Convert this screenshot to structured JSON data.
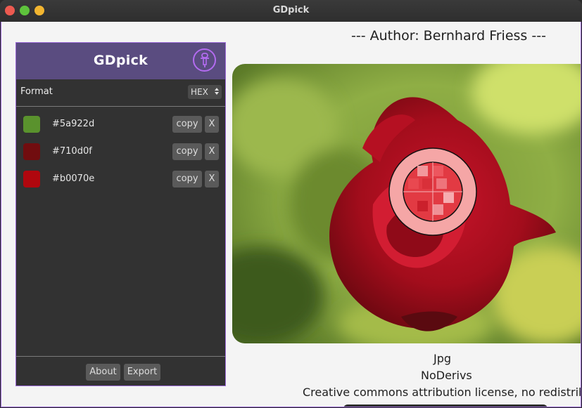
{
  "window": {
    "title": "GDpick"
  },
  "panel": {
    "title": "GDpick",
    "format_label": "Format",
    "format_value": "HEX",
    "colors": [
      {
        "hex": "#5a922d",
        "copy_label": "copy",
        "remove_label": "X"
      },
      {
        "hex": "#710d0f",
        "copy_label": "copy",
        "remove_label": "X"
      },
      {
        "hex": "#b0070e",
        "copy_label": "copy",
        "remove_label": "X"
      }
    ],
    "about_label": "About",
    "export_label": "Export"
  },
  "image": {
    "author": "--- Author: Bernhard Friess ---",
    "format": "Jpg",
    "license_short": "NoDerivs",
    "license_long": "Creative commons attribution license, no redistribution"
  },
  "colors": {
    "accent": "#9c6ad8",
    "header": "#5a4c80",
    "panel_bg": "#323232"
  },
  "icons": {
    "picker": "eyedropper-icon",
    "format_arrows": "updown-arrows-icon"
  }
}
